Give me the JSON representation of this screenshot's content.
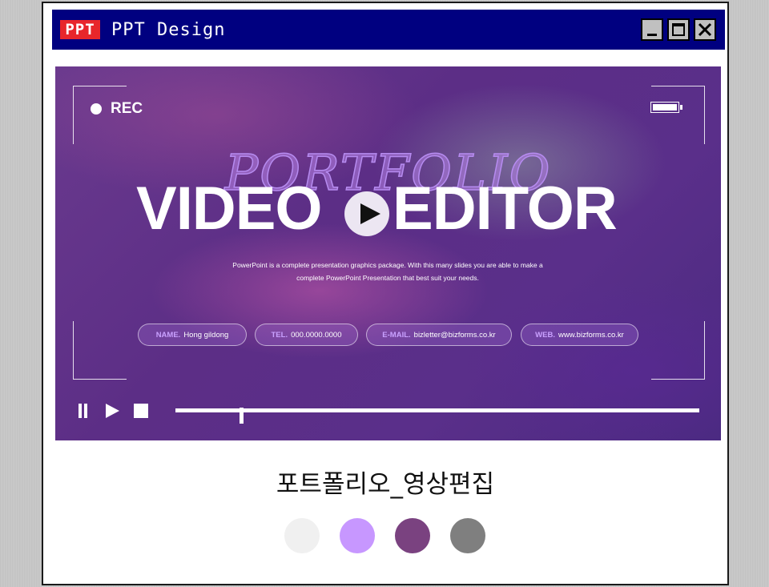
{
  "window": {
    "logo_text": "PPT",
    "title": "PPT Design",
    "buttons": [
      "minimize-icon",
      "maximize-icon",
      "close-icon"
    ]
  },
  "slide": {
    "rec_label": "REC",
    "script_title": "PORTFOLIO",
    "title_left": "VIDEO",
    "title_right": "EDITOR",
    "description_line1": "PowerPoint is a complete presentation graphics package. With this many slides you are able to make a",
    "description_line2": "complete PowerPoint Presentation that best suit your needs.",
    "contacts": [
      {
        "label": "NAME.",
        "value": "Hong gildong"
      },
      {
        "label": "TEL.",
        "value": "000.0000.0000"
      },
      {
        "label": "E-MAIL.",
        "value": "bizletter@bizforms.co.kr"
      },
      {
        "label": "WEB.",
        "value": "www.bizforms.co.kr"
      }
    ],
    "progress": 0.125
  },
  "caption": "포트폴리오_영상편집",
  "palette": [
    "#f0f0f0",
    "#c797ff",
    "#7a4280",
    "#7f7f7f"
  ],
  "colors": {
    "titlebar": "#000080",
    "logo_bg": "#e8262b",
    "accent": "#c9a1ff"
  }
}
